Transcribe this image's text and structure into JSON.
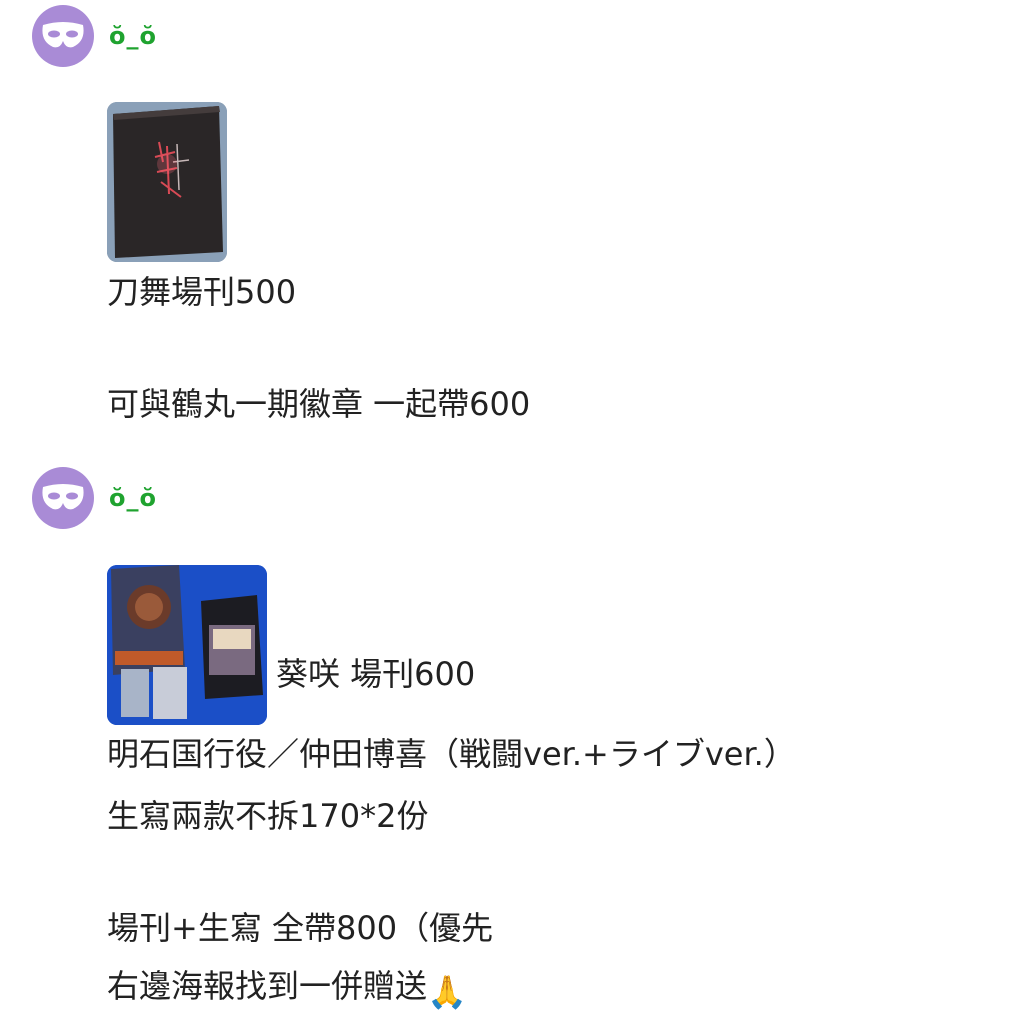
{
  "posts": [
    {
      "username": "ŏ_ŏ",
      "avatar_icon": "mask-icon",
      "photo_icon": "booklet-photo",
      "lines": [
        "刀舞場刊500",
        "可與鶴丸一期徽章 一起帶600"
      ]
    },
    {
      "username": "ŏ_ŏ",
      "avatar_icon": "mask-icon",
      "photo_icon": "goods-photo",
      "caption": "葵咲 場刊600",
      "lines": [
        "明石国行役／仲田博喜（戦闘ver.+ライブver.）",
        "生寫兩款不拆170*2份",
        "場刊+生寫 全帶800（優先",
        "右邊海報找到一併贈送"
      ],
      "trailing_emoji": "🙏"
    }
  ],
  "colors": {
    "avatar_bg": "#a98bd6",
    "username": "#1fa32f",
    "text": "#222222"
  }
}
